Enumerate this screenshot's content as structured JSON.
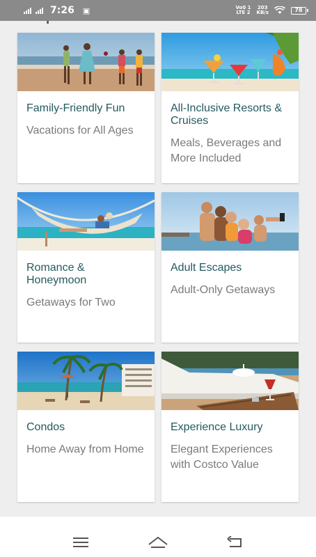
{
  "status_bar": {
    "time": "7:26",
    "network_top": "Vo0 1",
    "network_bottom": "LTE 2",
    "speed_top": "203",
    "speed_bottom": "KB/s",
    "battery": "78"
  },
  "section": {
    "title": "Popular Interests"
  },
  "cards": [
    {
      "title": "Family-Friendly Fun",
      "subtitle": "Vacations for All Ages"
    },
    {
      "title": "All-Inclusive Resorts & Cruises",
      "subtitle": "Meals, Beverages and More Included"
    },
    {
      "title": "Romance & Honeymoon",
      "subtitle": "Getaways for Two"
    },
    {
      "title": "Adult Escapes",
      "subtitle": "Adult-Only Getaways"
    },
    {
      "title": "Condos",
      "subtitle": "Home Away from Home"
    },
    {
      "title": "Experience Luxury",
      "subtitle": "Elegant Experiences with Costco Value"
    }
  ],
  "icons": {
    "menu": "menu-icon",
    "home": "home-icon",
    "back": "back-icon"
  },
  "colors": {
    "title_teal": "#245a5e",
    "subtitle_gray": "#7a7a7a",
    "status_bar": "#8a8a8a"
  }
}
